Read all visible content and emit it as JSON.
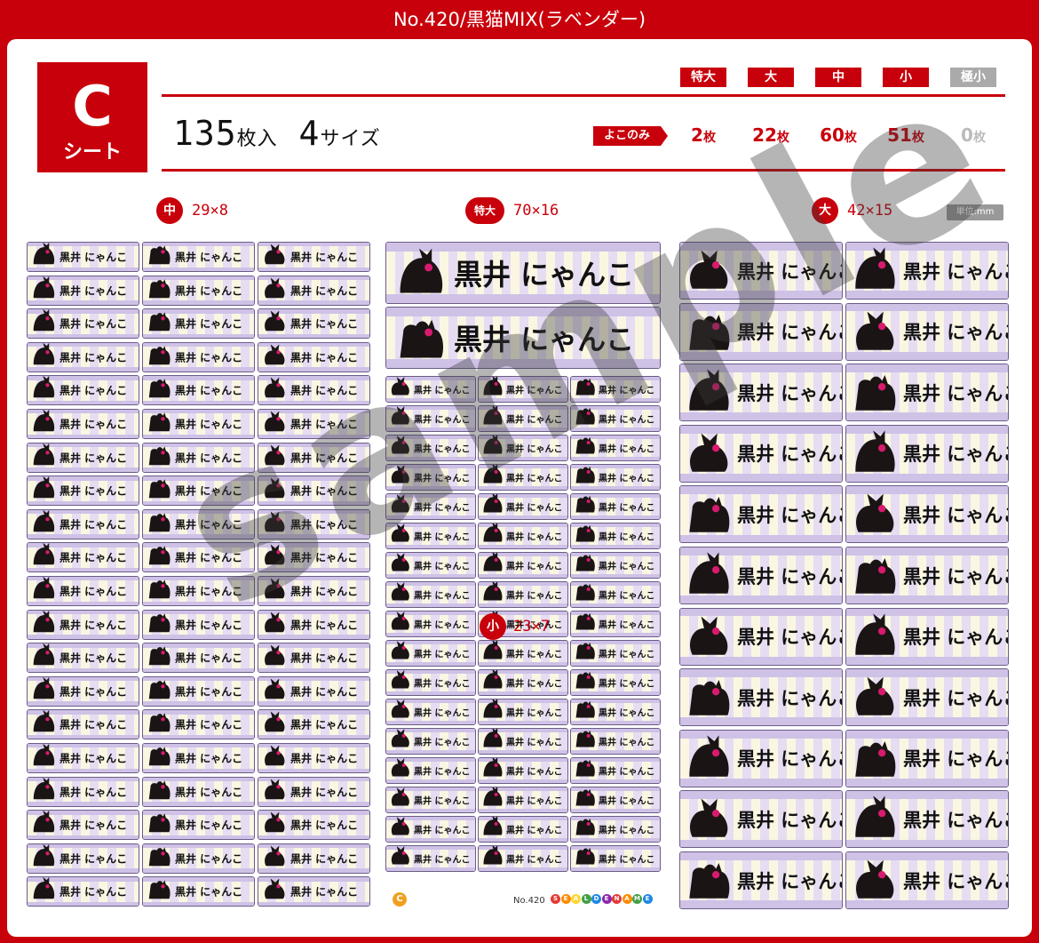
{
  "header": {
    "title": "No.420/黒猫MIX(ラベンダー)"
  },
  "sheet": {
    "badge_letter": "C",
    "badge_label": "シート"
  },
  "summary": {
    "count_number": "135",
    "count_unit": "枚入",
    "sizes_number": "4",
    "sizes_unit": "サイズ"
  },
  "size_tags": [
    {
      "label": "特大",
      "count": "2",
      "unit": "枚",
      "active": true
    },
    {
      "label": "大",
      "count": "22",
      "unit": "枚",
      "active": true
    },
    {
      "label": "中",
      "count": "60",
      "unit": "枚",
      "active": true
    },
    {
      "label": "小",
      "count": "51",
      "unit": "枚",
      "active": true
    },
    {
      "label": "極小",
      "count": "0",
      "unit": "枚",
      "active": false
    }
  ],
  "yoko_label": "よこのみ",
  "dimensions": {
    "medium": {
      "badge": "中",
      "size": "29×8"
    },
    "xlarge": {
      "badge": "特大",
      "size": "70×16"
    },
    "large": {
      "badge": "大",
      "size": "42×15"
    },
    "small": {
      "badge": "小",
      "size": "23×7"
    },
    "unit_label": "単位:mm"
  },
  "label_text": "黒井 にゃんこ",
  "watermark": "sample",
  "footer": {
    "sheet_letter": "C",
    "product_no": "No.420",
    "brand": [
      "S",
      "E",
      "A",
      "L",
      "D",
      "E",
      "N",
      "A",
      "M",
      "E"
    ]
  },
  "colors": {
    "brand_red": "#c8000b",
    "lavender": "#cfc2e6",
    "cream": "#fbf6e2",
    "cat": "#1a1414",
    "bow": "#d81b6e"
  }
}
